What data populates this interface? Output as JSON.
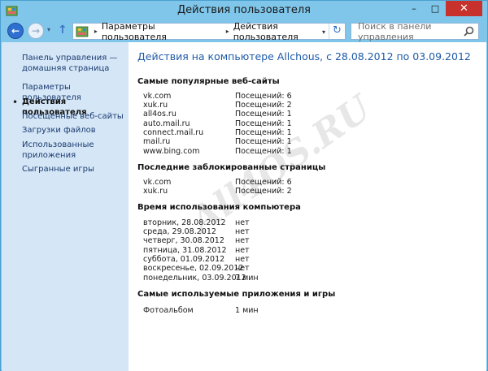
{
  "window": {
    "title": "Действия пользователя"
  },
  "titlebar_buttons": {
    "minimize": "–",
    "maximize": "□",
    "close": "✕"
  },
  "nav": {
    "back_glyph": "←",
    "forward_glyph": "→",
    "recent_glyph": "▾",
    "up_glyph": "↑",
    "breadcrumb": [
      "Параметры пользователя",
      "Действия пользователя"
    ],
    "breadcrumb_sep": "▸",
    "address_dropdown_glyph": "▾",
    "refresh_glyph": "↻",
    "search_placeholder": "Поиск в панели управления"
  },
  "sidebar": {
    "home_line1": "Панель управления —",
    "home_line2": "домашняя страница",
    "items": [
      {
        "label": "Параметры пользователя"
      },
      {
        "label": "Действия пользователя"
      },
      {
        "label": "Посещенные веб-сайты"
      },
      {
        "label": "Загрузки файлов"
      },
      {
        "label": "Использованные"
      },
      {
        "label": "приложения"
      },
      {
        "label": "Сыгранные игры"
      }
    ],
    "bullet": "•"
  },
  "main": {
    "heading": "Действия на компьютере Allchous, с 28.08.2012 по 03.09.2012",
    "sections": [
      {
        "title": "Самые популярные веб-сайты",
        "rows": [
          {
            "name": "vk.com",
            "value": "Посещений: 6"
          },
          {
            "name": "xuk.ru",
            "value": "Посещений: 2"
          },
          {
            "name": "all4os.ru",
            "value": "Посещений: 1"
          },
          {
            "name": "auto.mail.ru",
            "value": "Посещений: 1"
          },
          {
            "name": "connect.mail.ru",
            "value": "Посещений: 1"
          },
          {
            "name": "mail.ru",
            "value": "Посещений: 1"
          },
          {
            "name": "www.bing.com",
            "value": "Посещений: 1"
          }
        ]
      },
      {
        "title": "Последние заблокированные страницы",
        "rows": [
          {
            "name": "vk.com",
            "value": "Посещений: 6"
          },
          {
            "name": "xuk.ru",
            "value": "Посещений: 2"
          }
        ]
      },
      {
        "title": "Время использования компьютера",
        "rows": [
          {
            "name": "вторник, 28.08.2012",
            "value": "нет"
          },
          {
            "name": "среда, 29.08.2012",
            "value": "нет"
          },
          {
            "name": "четверг, 30.08.2012",
            "value": "нет"
          },
          {
            "name": "пятница, 31.08.2012",
            "value": "нет"
          },
          {
            "name": "суббота, 01.09.2012",
            "value": "нет"
          },
          {
            "name": "воскресенье, 02.09.2012",
            "value": "нет"
          },
          {
            "name": "понедельник, 03.09.2012",
            "value": "7 мин"
          }
        ]
      },
      {
        "title": "Самые используемые приложения и игры",
        "rows": [
          {
            "name": "Фотоальбом",
            "value": "1 мин"
          }
        ]
      }
    ]
  },
  "watermark": "All4OS.RU"
}
